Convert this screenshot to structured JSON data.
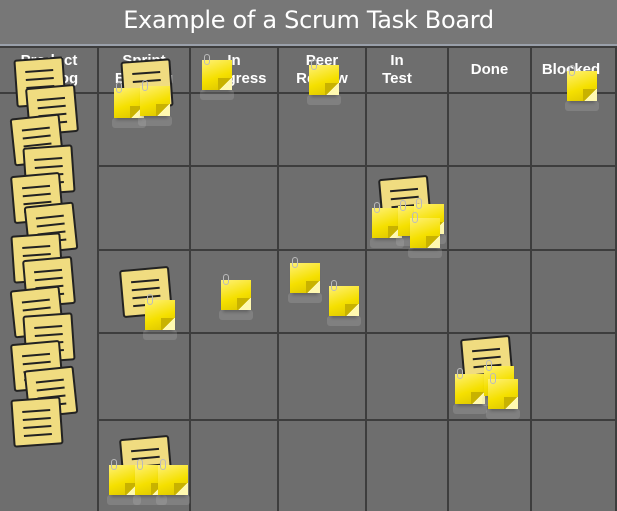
{
  "title": "Example of a Scrum Task Board",
  "columns": [
    {
      "label_line1": "Product",
      "label_line2": "Backlog"
    },
    {
      "label_line1": "Sprint",
      "label_line2": "Backlog"
    },
    {
      "label_line1": "In",
      "label_line2": "Progress"
    },
    {
      "label_line1": "Peer",
      "label_line2": "Review"
    },
    {
      "label_line1": "In",
      "label_line2": "Test"
    },
    {
      "label_line1": "Done",
      "label_line2": ""
    },
    {
      "label_line1": "Blocked",
      "label_line2": ""
    }
  ],
  "story_rows": 5,
  "colors": {
    "board_background": "#6e6e6e",
    "grid_line": "#3d3d3d",
    "story_note": "#f0dc80",
    "task_note": "#f5e000"
  },
  "rows": [
    {
      "story": "story-1",
      "tasks": {
        "sprint_backlog": 2,
        "in_progress": 1,
        "peer_review": 1,
        "in_test": 0,
        "done": 0,
        "blocked": 1
      }
    },
    {
      "story": "story-2",
      "tasks": {
        "sprint_backlog": 0,
        "in_progress": 0,
        "peer_review": 0,
        "in_test": 4,
        "done": 0,
        "blocked": 0
      }
    },
    {
      "story": "story-3",
      "tasks": {
        "sprint_backlog": 1,
        "in_progress": 1,
        "peer_review": 2,
        "in_test": 0,
        "done": 0,
        "blocked": 0
      }
    },
    {
      "story": "story-4",
      "tasks": {
        "sprint_backlog": 0,
        "in_progress": 0,
        "peer_review": 0,
        "in_test": 0,
        "done": 3,
        "blocked": 0
      }
    },
    {
      "story": "story-5",
      "tasks": {
        "sprint_backlog": 3,
        "in_progress": 0,
        "peer_review": 0,
        "in_test": 0,
        "done": 0,
        "blocked": 0
      }
    }
  ],
  "product_backlog_story_count": 13
}
